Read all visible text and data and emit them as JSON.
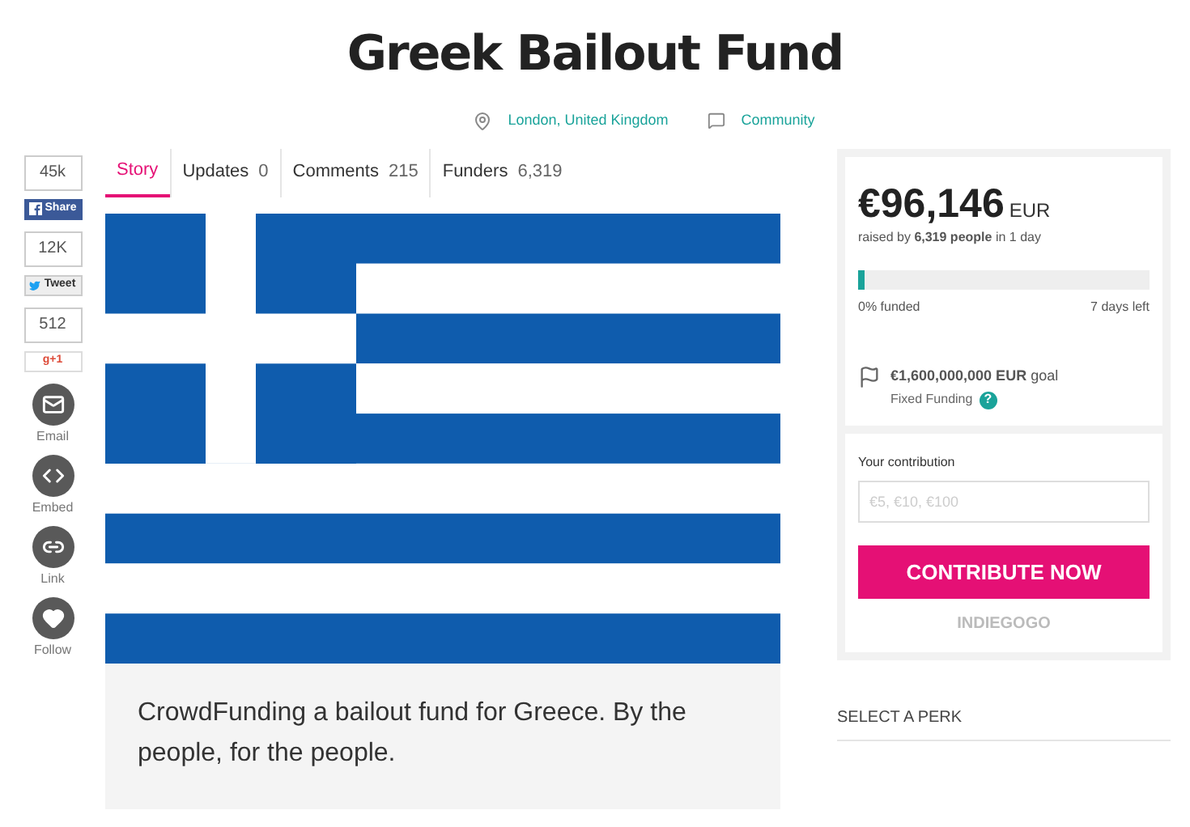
{
  "title": "Greek Bailout Fund",
  "meta": [
    {
      "kind": "location",
      "text": "London, United Kingdom"
    },
    {
      "kind": "category",
      "text": "Community"
    }
  ],
  "share": [
    {
      "kind": "count",
      "count": "45k",
      "label": "Share"
    },
    {
      "kind": "count",
      "count": "12K",
      "label": "Tweet"
    },
    {
      "kind": "count",
      "count": "512",
      "label": "g+1"
    },
    {
      "kind": "circle",
      "label": "Email"
    },
    {
      "kind": "circle",
      "label": "Embed"
    },
    {
      "kind": "circle",
      "label": "Link"
    },
    {
      "kind": "circle",
      "label": "Follow"
    }
  ],
  "tabs": [
    {
      "label": "Story",
      "selected": true
    },
    {
      "label": "Updates",
      "count": "0",
      "selected": false
    },
    {
      "label": "Comments",
      "count": "215",
      "selected": false
    },
    {
      "label": "Funders",
      "count": "6,319",
      "selected": false
    }
  ],
  "description": "CrowdFunding a bailout fund for Greece. By the people, for the people.",
  "funding": {
    "amount": "€96,146",
    "currency": "EUR",
    "raised": "raised by **6,319 people** in 1 day",
    "level": 0.02,
    "funded": "0% funded",
    "time_left": "7 days left",
    "goal": "**€1,600,000,000 EUR** goal",
    "goal_type": "Fixed Funding",
    "help": "?"
  },
  "contribution": {
    "label": "Your contribution",
    "placeholder": "€5, €10, €100",
    "button": "CONTRIBUTE NOW",
    "brand": "INDIEGOGO"
  },
  "perk_heading": "SELECT A PERK"
}
